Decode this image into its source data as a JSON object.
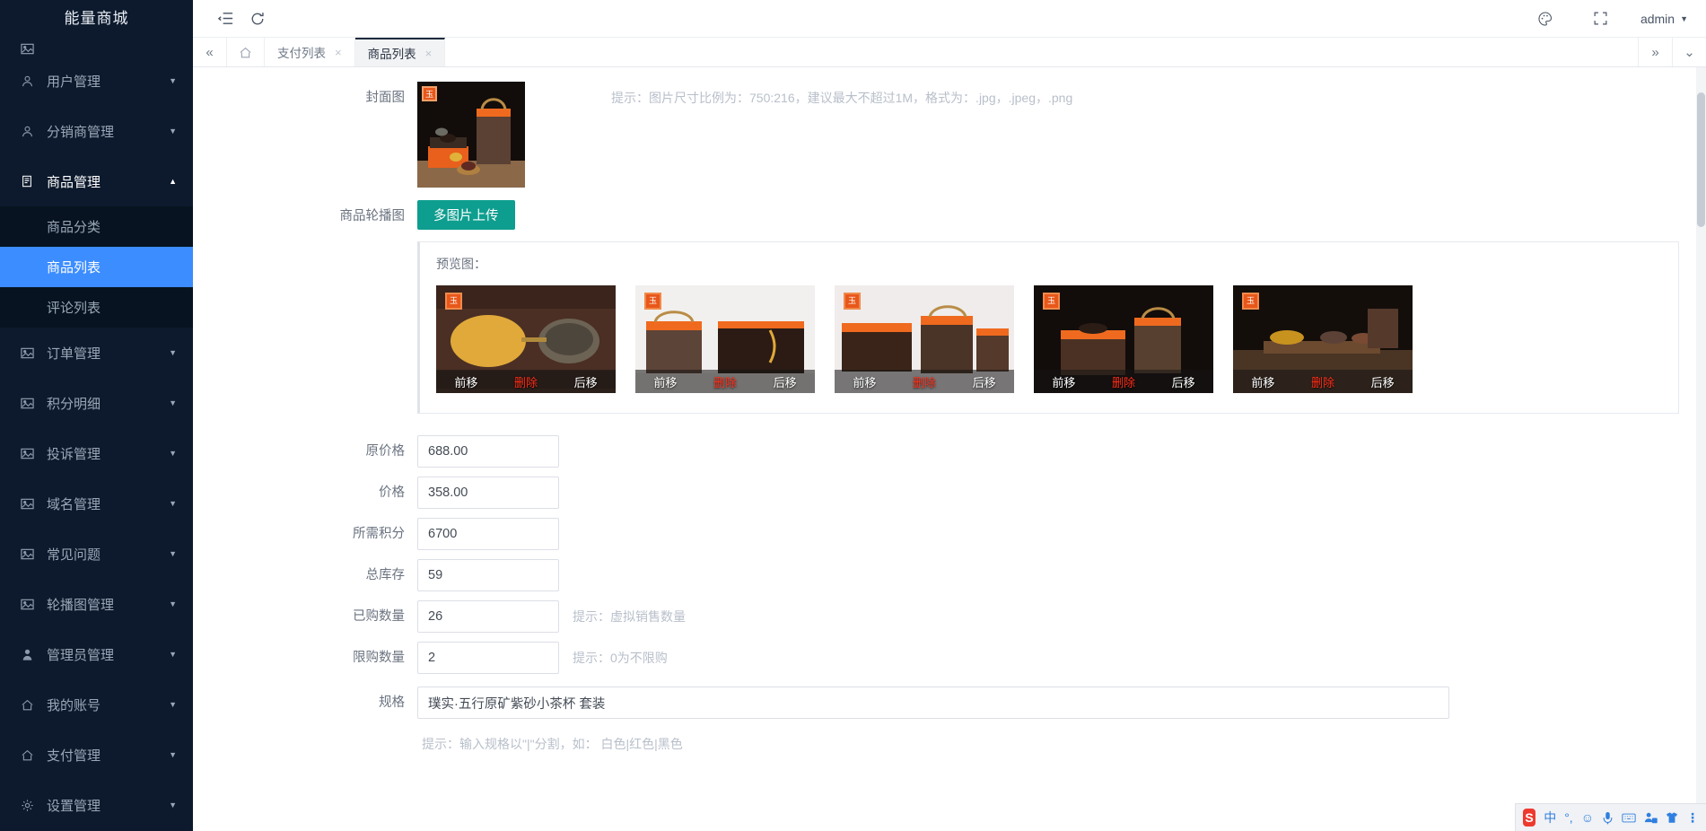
{
  "sidebar": {
    "brand": "能量商城",
    "items": [
      {
        "label": "",
        "icon": "image-icon",
        "arrow": "",
        "partial": true
      },
      {
        "label": "用户管理",
        "icon": "user-icon",
        "arrow": "▼"
      },
      {
        "label": "分销商管理",
        "icon": "user-icon",
        "arrow": "▼"
      },
      {
        "label": "商品管理",
        "icon": "doc-icon",
        "arrow": "▲",
        "open": true
      },
      {
        "label": "订单管理",
        "icon": "image-icon",
        "arrow": "▼"
      },
      {
        "label": "积分明细",
        "icon": "image-icon",
        "arrow": "▼"
      },
      {
        "label": "投诉管理",
        "icon": "image-icon",
        "arrow": "▼"
      },
      {
        "label": "域名管理",
        "icon": "image-icon",
        "arrow": "▼"
      },
      {
        "label": "常见问题",
        "icon": "image-icon",
        "arrow": "▼"
      },
      {
        "label": "轮播图管理",
        "icon": "image-icon",
        "arrow": "▼"
      },
      {
        "label": "管理员管理",
        "icon": "person-icon",
        "arrow": "▼"
      },
      {
        "label": "我的账号",
        "icon": "home-icon",
        "arrow": "▼"
      },
      {
        "label": "支付管理",
        "icon": "home-icon",
        "arrow": "▼"
      },
      {
        "label": "设置管理",
        "icon": "gear-icon",
        "arrow": "▼"
      }
    ],
    "submenu": [
      {
        "label": "商品分类",
        "active": false
      },
      {
        "label": "商品列表",
        "active": true
      },
      {
        "label": "评论列表",
        "active": false
      }
    ],
    "active_color": "#3c8dff",
    "bg_color": "#0d1a2d"
  },
  "topbar": {
    "collapse_icon": "collapse-menu-icon",
    "refresh_icon": "refresh-icon",
    "theme_icon": "palette-icon",
    "fullscreen_icon": "fullscreen-icon",
    "user": "admin",
    "user_caret": "▼"
  },
  "tabbar": {
    "prev_icon": "«",
    "home_icon": "home-icon",
    "tabs": [
      {
        "label": "支付列表",
        "close": "×",
        "active": false
      },
      {
        "label": "商品列表",
        "close": "×",
        "active": true
      }
    ],
    "next_icon": "»",
    "dropdown_icon": "⌄"
  },
  "form": {
    "cover": {
      "label": "封面图",
      "badge": "玉",
      "hint": "提示：图片尺寸比例为：750:216，建议最大不超过1M，格式为：.jpg，.jpeg，.png"
    },
    "carousel": {
      "label": "商品轮播图",
      "upload_button": "多图片上传",
      "upload_button_color": "#0e9e8f",
      "preview_title": "预览图：",
      "thumbs": [
        {
          "badge": "玉",
          "prev": "前移",
          "delete": "删除",
          "next": "后移"
        },
        {
          "badge": "玉",
          "prev": "前移",
          "delete": "删除",
          "next": "后移"
        },
        {
          "badge": "玉",
          "prev": "前移",
          "delete": "删除",
          "next": "后移"
        },
        {
          "badge": "玉",
          "prev": "前移",
          "delete": "删除",
          "next": "后移"
        },
        {
          "badge": "玉",
          "prev": "前移",
          "delete": "删除",
          "next": "后移"
        }
      ],
      "delete_color": "#ff2d17"
    },
    "fields": [
      {
        "label": "原价格",
        "value": "688.00",
        "hint": ""
      },
      {
        "label": "价格",
        "value": "358.00",
        "hint": ""
      },
      {
        "label": "所需积分",
        "value": "6700",
        "hint": ""
      },
      {
        "label": "总库存",
        "value": "59",
        "hint": ""
      },
      {
        "label": "已购数量",
        "value": "26",
        "hint": "提示：虚拟销售数量"
      },
      {
        "label": "限购数量",
        "value": "2",
        "hint": "提示：0为不限购"
      }
    ],
    "spec": {
      "label": "规格",
      "value": "璞实·五行原矿紫砂小茶杯 套装",
      "hint": "提示：输入规格以\"|\"分割，如： 白色|红色|黑色"
    }
  },
  "ime": {
    "logo": "S",
    "lang": "中",
    "punct": "°,",
    "emoji": "☺",
    "mic": "🎤",
    "keyboard": "⌨",
    "user": "16",
    "shirt": "👕",
    "menu": "⋮"
  }
}
